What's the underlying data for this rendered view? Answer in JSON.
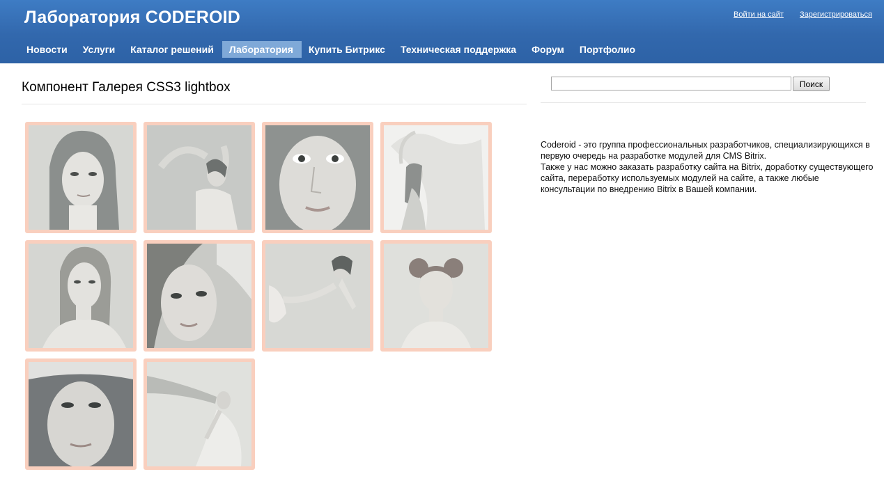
{
  "header": {
    "site_title": "Лаборатория CODEROID",
    "login_link": "Войти на сайт",
    "register_link": "Зарегистрироваться"
  },
  "nav": {
    "items": [
      {
        "label": "Новости"
      },
      {
        "label": "Услуги"
      },
      {
        "label": "Каталог решений"
      },
      {
        "label": "Лаборатория",
        "active": true
      },
      {
        "label": "Купить Битрикс"
      },
      {
        "label": "Техническая поддержка"
      },
      {
        "label": "Форум"
      },
      {
        "label": "Портфолио"
      }
    ]
  },
  "main": {
    "title": "Компонент Галерея CSS3 lightbox",
    "gallery": {
      "thumbnails": [
        {
          "subject": "portrait"
        },
        {
          "subject": "pose-arms-up"
        },
        {
          "subject": "face-closeup"
        },
        {
          "subject": "veil-pose"
        },
        {
          "subject": "portrait"
        },
        {
          "subject": "face-closeup"
        },
        {
          "subject": "arm-stretch"
        },
        {
          "subject": "hair-buns-portrait"
        },
        {
          "subject": "flower-crown-face"
        },
        {
          "subject": "dancing-dress"
        }
      ]
    }
  },
  "sidebar": {
    "search": {
      "value": "",
      "button_label": "Поиск"
    },
    "about": {
      "line1": "Coderoid - это группа профессиональных разработчиков, специализирующихся в первую очередь на разработке модулей для CMS Bitrix.",
      "line2": "Также у нас можно заказать разработку сайта на Bitrix, доработку существующего сайта, переработку используемых модулей на сайте, а также любые консультации по внедрению Bitrix в Вашей компании."
    }
  },
  "colors": {
    "header_top": "#3e7cc4",
    "header_bottom": "#2d62a6",
    "nav_active": "#7fa9d8",
    "thumb_border": "#f9cfbe"
  }
}
